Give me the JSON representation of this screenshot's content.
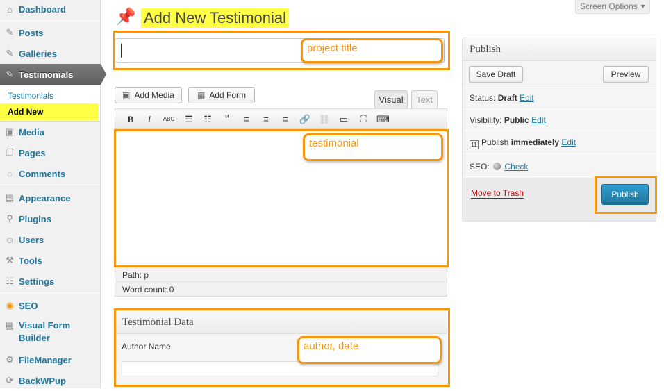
{
  "menu": {
    "items": [
      {
        "label": "Dashboard",
        "icon": "dashboard-icon"
      },
      {
        "label": "Posts",
        "icon": "pushpin-icon"
      },
      {
        "label": "Galleries",
        "icon": "pushpin-icon"
      },
      {
        "label": "Testimonials",
        "icon": "pushpin-icon"
      },
      {
        "label": "Media",
        "icon": "media-icon"
      },
      {
        "label": "Pages",
        "icon": "pages-icon"
      },
      {
        "label": "Comments",
        "icon": "comment-icon"
      },
      {
        "label": "Appearance",
        "icon": "appearance-icon"
      },
      {
        "label": "Plugins",
        "icon": "plugin-icon"
      },
      {
        "label": "Users",
        "icon": "users-icon"
      },
      {
        "label": "Tools",
        "icon": "tools-icon"
      },
      {
        "label": "Settings",
        "icon": "settings-icon"
      },
      {
        "label": "SEO",
        "icon": "seo-icon"
      },
      {
        "label": "Visual Form Builder",
        "icon": "form-icon"
      },
      {
        "label": "FileManager",
        "icon": "gear-icon"
      },
      {
        "label": "BackWPup",
        "icon": "backup-icon"
      }
    ],
    "submenu": {
      "testimonials": "Testimonials",
      "add_new": "Add New"
    }
  },
  "header": {
    "title": "Add New Testimonial",
    "screen_options": "Screen Options"
  },
  "editor": {
    "title_value": "",
    "add_media": "Add Media",
    "add_form": "Add Form",
    "tab_visual": "Visual",
    "tab_text": "Text",
    "path": "Path: p",
    "word_count": "Word count: 0"
  },
  "callouts": {
    "project_title": "project title",
    "testimonial": "testimonial",
    "author_date": "author, date"
  },
  "testimonial_data": {
    "title": "Testimonial Data",
    "author_label": "Author Name",
    "author_value": ""
  },
  "publish": {
    "title": "Publish",
    "save_draft": "Save Draft",
    "preview": "Preview",
    "status_label": "Status:",
    "status_value": "Draft",
    "visibility_label": "Visibility:",
    "visibility_value": "Public",
    "publish_label": "Publish",
    "publish_value": "immediately",
    "seo_label": "SEO:",
    "seo_check": "Check",
    "edit": "Edit",
    "move_to_trash": "Move to Trash",
    "publish_button": "Publish"
  },
  "colors": {
    "highlight": "#ffff44",
    "annotation": "#f5960f",
    "link": "#21759b",
    "primary": "#21759b",
    "trash": "#bc0b0b"
  }
}
